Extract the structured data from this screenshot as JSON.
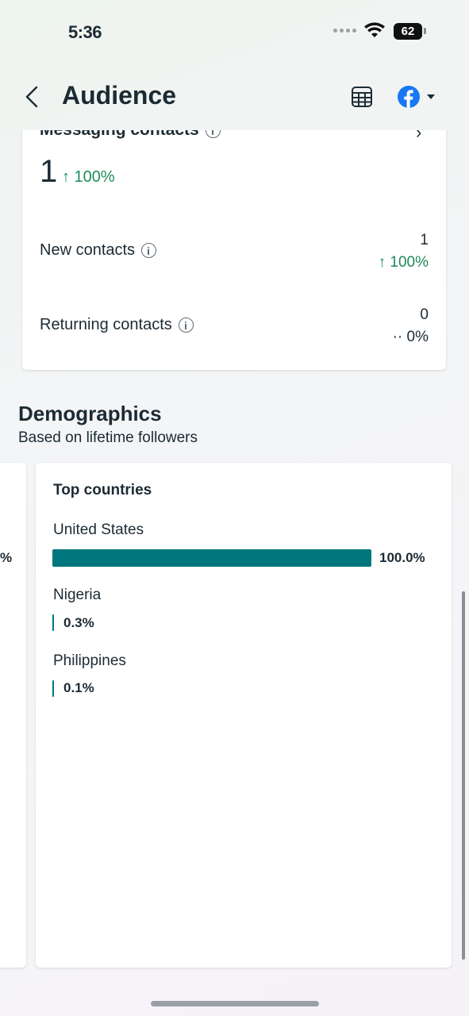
{
  "status_bar": {
    "time": "5:36",
    "battery": "62"
  },
  "header": {
    "title": "Audience"
  },
  "messaging": {
    "title": "Messaging contacts",
    "total": "1",
    "total_change": "↑ 100%",
    "rows": [
      {
        "label": "New contacts",
        "value": "1",
        "change": "↑ 100%"
      },
      {
        "label": "Returning contacts",
        "value": "0",
        "change": "·· 0%"
      }
    ]
  },
  "demographics": {
    "title": "Demographics",
    "subtitle": "Based on lifetime followers",
    "left_card_pct": "%",
    "top_countries": {
      "title": "Top countries",
      "items": [
        {
          "name": "United States",
          "pct_label": "100.0%",
          "fraction": 1.0
        },
        {
          "name": "Nigeria",
          "pct_label": "0.3%",
          "fraction": 0.003
        },
        {
          "name": "Philippines",
          "pct_label": "0.1%",
          "fraction": 0.001
        }
      ]
    }
  },
  "colors": {
    "accent": "#00777c",
    "positive": "#1e8a5b",
    "facebook": "#1877f2"
  }
}
